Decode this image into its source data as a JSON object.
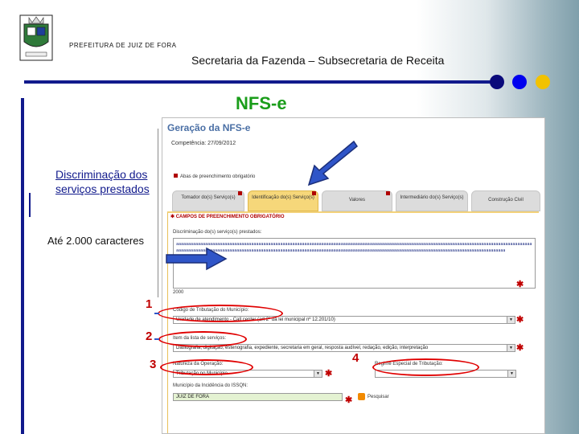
{
  "header": {
    "org": "PREFEITURA DE JUIZ DE FORA",
    "dept": "Secretaria da Fazenda – Subsecretaria de Receita"
  },
  "slide_title": "NFS-e",
  "annotations": {
    "discriminacao": "Discriminação dos serviços prestados",
    "chars": "Até 2.000 caracteres",
    "n1": "1",
    "n2": "2",
    "n3": "3",
    "n4": "4"
  },
  "colors": {
    "accent_dark": "#111a8c",
    "title_green": "#1a9d1a",
    "highlight_red": "#e00000",
    "arrow_blue": "#2f55c8",
    "tab_active": "#f6d77a"
  },
  "form": {
    "title": "Geração da NFS-e",
    "competencia": "Competência: 27/09/2012",
    "legend": "Abas de preenchimento obrigatório",
    "tabs": [
      {
        "label": "Tomador do(s) Serviço(s)"
      },
      {
        "label": "Identificação do(s) Serviço(s)"
      },
      {
        "label": "Valores"
      },
      {
        "label": "Intermediário do(s) Serviço(s)"
      },
      {
        "label": "Construção Civil"
      }
    ],
    "section_title": "✱ CAMPOS DE PREENCHIMENTO OBRIGATÓRIO",
    "discriminacao_label": "Discriminação do(s) serviço(s) prestados:",
    "discriminacao_value": "aaaaaaaaaaaaaaaaaaaaaaaaaaaaaaaaaaaaaaaaaaaaaaaaaaaaaaaaaaaaaaaaaaaaaaaaaaaaaaaaaaaaaaaaaaaaaaaaaaaaaaaaaaaaaaaaaaaaaaaaaaaaaaaaaaaaaaaaaaaaaaaaaaaaaaaaaaaaaaaaaaaaaaaaaaaaaaaaaaaaaaaaaaaaaaaaaaaaaaaaaaaaaaaaaaaaaaaaaaaaaaaaaaaaaaaaaaaaaaaaaaaaaaaaaaaaaaaaaaaaaaaaaaaaaaaaaaaaaaaaaaa",
    "count": "2000",
    "codigo_label": "Código de Tributação do Município:",
    "codigo_value": "Unidade de atendimento - Call center (art 2º da lei municipal nº 12.201/10)",
    "item_label": "Item da lista de serviços:",
    "item_value": "Datilografia, digitação, estenografia, expediente, secretaria em geral, resposta audível, redação, edição, interpretação",
    "natureza_label": "Natureza da Operação:",
    "natureza_value": "Tributação no Município",
    "regime_label": "Regime Especial de Tributação:",
    "municipio_label": "Município da Incidência do ISSQN:",
    "municipio_value": "JUIZ DE FORA",
    "search_label": "Pesquisar",
    "required_mark": "✱"
  }
}
